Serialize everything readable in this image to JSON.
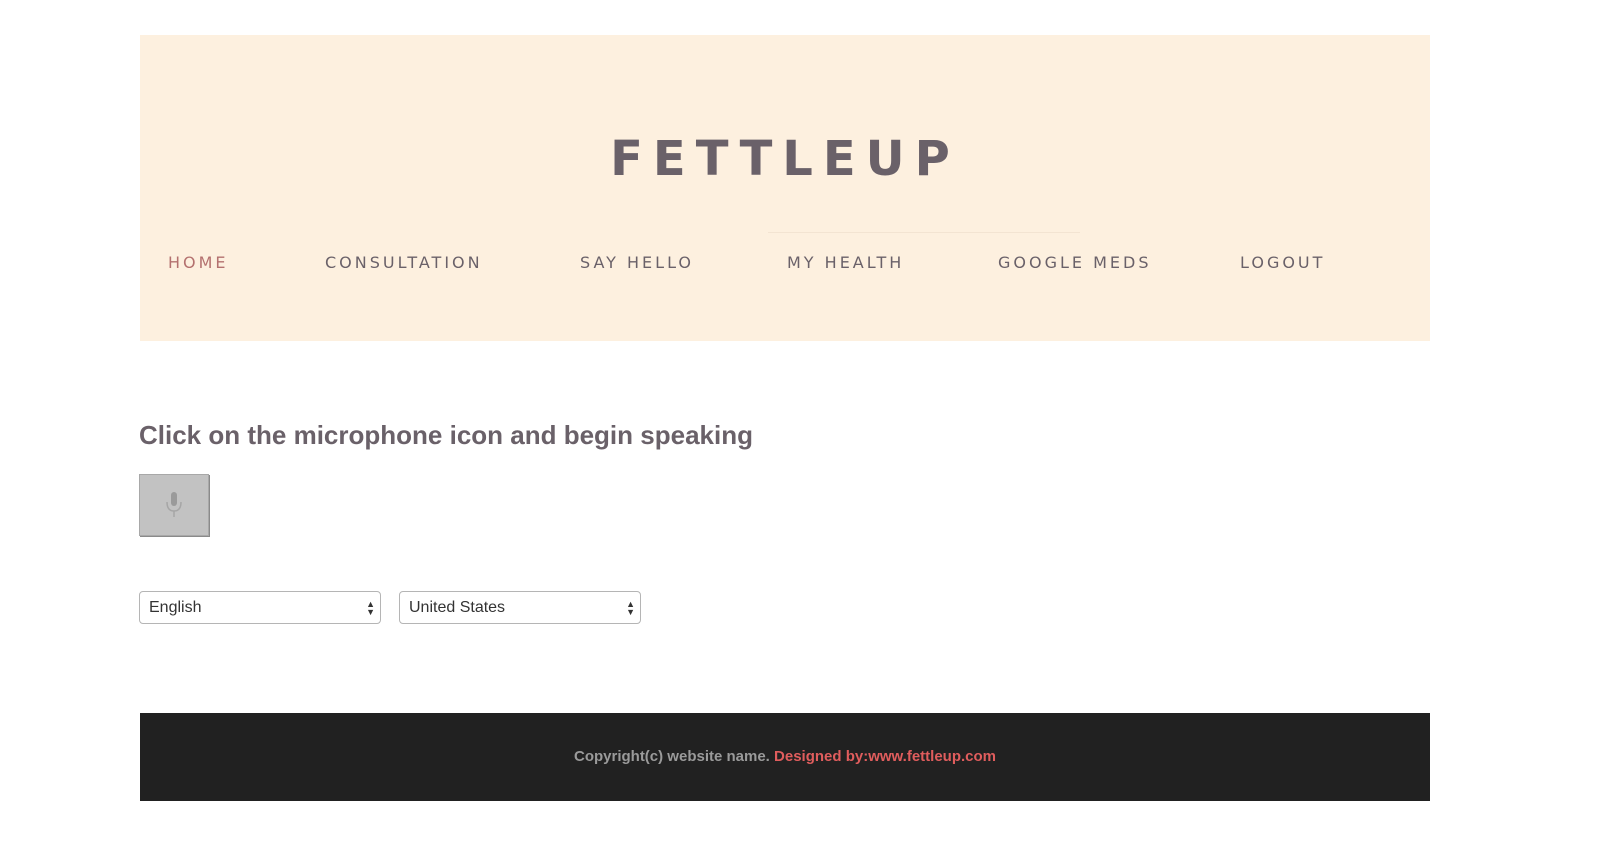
{
  "header": {
    "logo": "FETTLEUP",
    "nav": [
      {
        "label": "HOME",
        "active": true
      },
      {
        "label": "CONSULTATION",
        "active": false
      },
      {
        "label": "SAY HELLO",
        "active": false
      },
      {
        "label": "MY HEALTH",
        "active": false
      },
      {
        "label": "GOOGLE MEDS",
        "active": false
      },
      {
        "label": "LOGOUT",
        "active": false
      }
    ]
  },
  "main": {
    "title": "Click on the microphone icon and begin speaking",
    "mic_icon": "microphone-icon",
    "language_select": {
      "value": "English"
    },
    "dialect_select": {
      "value": "United States"
    }
  },
  "footer": {
    "copyright": "Copyright(c) website name.",
    "credit": "Designed by:www.fettleup.com"
  },
  "colors": {
    "header_bg": "#fdf0df",
    "text": "#6a6169",
    "nav_active": "#b4716f",
    "footer_bg": "#212121",
    "footer_credit": "#e05d5d"
  }
}
